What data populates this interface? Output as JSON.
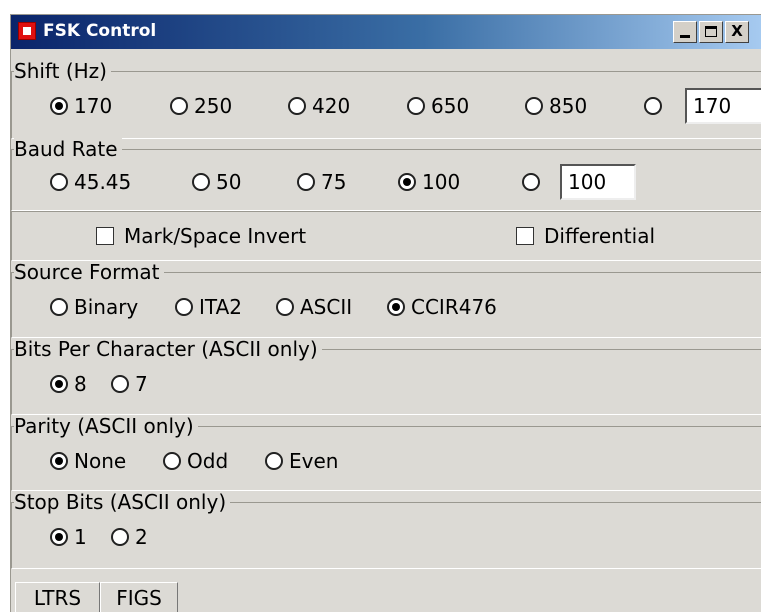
{
  "window": {
    "title": "FSK Control",
    "controls": {
      "minimize": "_",
      "maximize": "□",
      "close": "X"
    }
  },
  "shift": {
    "label": "Shift (Hz)",
    "options": [
      "170",
      "250",
      "420",
      "650",
      "850"
    ],
    "selected": "170",
    "custom_value": "170"
  },
  "baud": {
    "label": "Baud Rate",
    "options": [
      "45.45",
      "50",
      "75",
      "100"
    ],
    "selected": "100",
    "custom_value": "100"
  },
  "invert": {
    "mark_space_label": "Mark/Space Invert",
    "mark_space_checked": false,
    "differential_label": "Differential",
    "differential_checked": false
  },
  "source": {
    "label": "Source Format",
    "options": [
      "Binary",
      "ITA2",
      "ASCII",
      "CCIR476"
    ],
    "selected": "CCIR476"
  },
  "bits": {
    "label": "Bits Per Character  (ASCII only)",
    "options": [
      "8",
      "7"
    ],
    "selected": "8"
  },
  "parity": {
    "label": "Parity  (ASCII only)",
    "options": [
      "None",
      "Odd",
      "Even"
    ],
    "selected": "None"
  },
  "stop": {
    "label": "Stop Bits  (ASCII only)",
    "options": [
      "1",
      "2"
    ],
    "selected": "1"
  },
  "buttons": {
    "ltrs": "LTRS",
    "figs": "FIGS"
  }
}
